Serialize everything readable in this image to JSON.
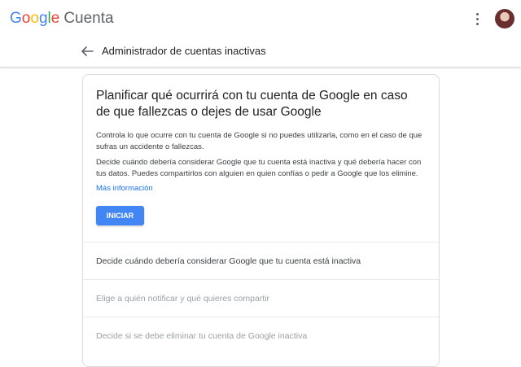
{
  "header": {
    "logo_letters": [
      "G",
      "o",
      "o",
      "g",
      "l",
      "e"
    ],
    "product": "Cuenta",
    "more_icon": "more-vert-icon",
    "avatar_icon": "account-avatar"
  },
  "subheader": {
    "back_icon": "arrow-back-icon",
    "title": "Administrador de cuentas inactivas"
  },
  "card": {
    "heading": "Planificar qué ocurrirá con tu cuenta de Google en caso de que fallezcas o dejes de usar Google",
    "paragraph1": "Controla lo que ocurre con tu cuenta de Google si no puedes utilizarla, como en el caso de que sufras un accidente o fallezcas.",
    "paragraph2": "Decide cuándo debería considerar Google que tu cuenta está inactiva y qué debería hacer con tus datos. Puedes compartirlos con alguien en quien confías o pedir a Google que los elimine.",
    "link": "Más información",
    "button": "INICIAR"
  },
  "steps": [
    {
      "label": "Decide cuándo debería considerar Google que tu cuenta está inactiva"
    },
    {
      "label": "Elige a quién notificar y qué quieres compartir"
    },
    {
      "label": "Decide si se debe eliminar tu cuenta de Google inactiva"
    }
  ],
  "colors": {
    "google_blue": "#4285f4",
    "google_red": "#ea4335",
    "google_yellow": "#fbbc05",
    "google_green": "#34a853",
    "link": "#1a73e8",
    "button_bg": "#4285f4"
  }
}
